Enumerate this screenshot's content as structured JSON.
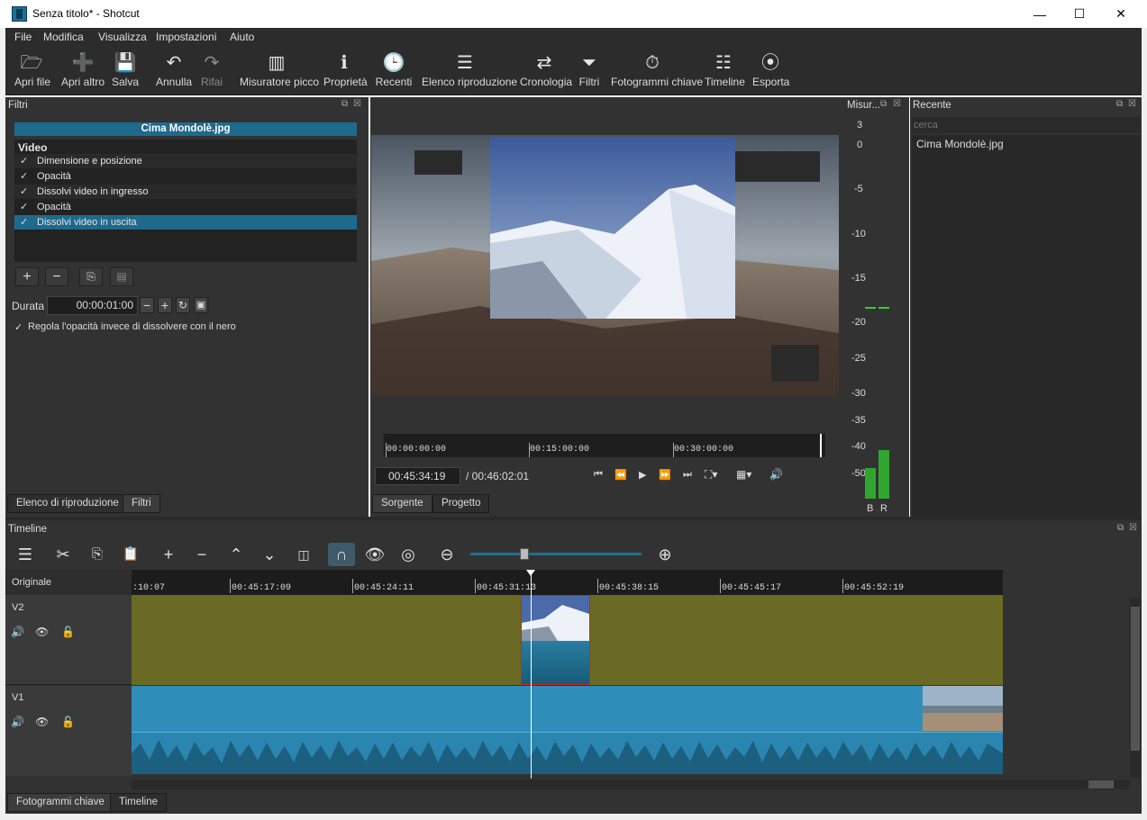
{
  "window": {
    "title": "Senza titolo* - Shotcut",
    "min": "—",
    "max": "☐",
    "close": "✕"
  },
  "menu": [
    "File",
    "Modifica",
    "Visualizza",
    "Impostazioni",
    "Aiuto"
  ],
  "toolbar": [
    {
      "label": "Apri file",
      "icon": "folder-open-icon",
      "glyph": "🗁"
    },
    {
      "label": "Apri altro",
      "icon": "open-other-icon",
      "glyph": "➕"
    },
    {
      "label": "Salva",
      "icon": "save-icon",
      "glyph": "💾"
    },
    {
      "label": "Annulla",
      "icon": "undo-icon",
      "glyph": "↶"
    },
    {
      "label": "Rifai",
      "icon": "redo-icon",
      "glyph": "↷"
    },
    {
      "label": "Misuratore picco",
      "icon": "peak-meter-icon",
      "glyph": "▥"
    },
    {
      "label": "Proprietà",
      "icon": "info-icon",
      "glyph": "ℹ"
    },
    {
      "label": "Recenti",
      "icon": "clock-icon",
      "glyph": "🕒"
    },
    {
      "label": "Elenco riproduzione",
      "icon": "list-icon",
      "glyph": "☰"
    },
    {
      "label": "Cronologia",
      "icon": "history-icon",
      "glyph": "⇄"
    },
    {
      "label": "Filtri",
      "icon": "filter-icon",
      "glyph": "⏷"
    },
    {
      "label": "Fotogrammi chiave",
      "icon": "stopwatch-icon",
      "glyph": "⏱"
    },
    {
      "label": "Timeline",
      "icon": "timeline-icon",
      "glyph": "☷"
    },
    {
      "label": "Esporta",
      "icon": "disc-icon",
      "glyph": "⦿"
    }
  ],
  "filters_panel": {
    "title": "Filtri",
    "clip_name": "Cima Mondolè.jpg",
    "group": "Video",
    "items": [
      "Dimensione e posizione",
      "Opacità",
      "Dissolvi video in ingresso",
      "Opacità",
      "Dissolvi video in uscita"
    ],
    "selected_index": 4,
    "duration_label": "Durata",
    "duration_value": "00:00:01:00",
    "checkbox_label": "Regola l'opacità invece di dissolvere con il nero",
    "tabs": [
      "Elenco di riproduzione",
      "Filtri"
    ]
  },
  "viewer": {
    "ruler": [
      "00:00:00:00",
      "00:15:00:00",
      "00:30:00:00"
    ],
    "current_time": "00:45:34:19",
    "total_time": "/ 00:46:02:01",
    "tabs": [
      "Sorgente",
      "Progetto"
    ]
  },
  "meter": {
    "title": "Misur...",
    "scale": [
      "3",
      "0",
      "-5",
      "-10",
      "-15",
      "-20",
      "-25",
      "-30",
      "-35",
      "-40",
      "-50"
    ],
    "channels": [
      "B",
      "R"
    ]
  },
  "recent": {
    "title": "Recente",
    "search_placeholder": "cerca",
    "items": [
      "Cima Mondolè.jpg"
    ]
  },
  "timeline": {
    "title": "Timeline",
    "header_label": "Originale",
    "ruler": [
      ":10:07",
      "00:45:17:09",
      "00:45:24:11",
      "00:45:31:13",
      "00:45:38:15",
      "00:45:45:17",
      "00:45:52:19"
    ],
    "tracks": [
      "V2",
      "V1"
    ],
    "tabs": [
      "Fotogrammi chiave",
      "Timeline"
    ]
  },
  "colors": {
    "accent": "#1e6a8c",
    "v2_track": "#6b6a25",
    "v1_clip": "#2a86b0"
  }
}
